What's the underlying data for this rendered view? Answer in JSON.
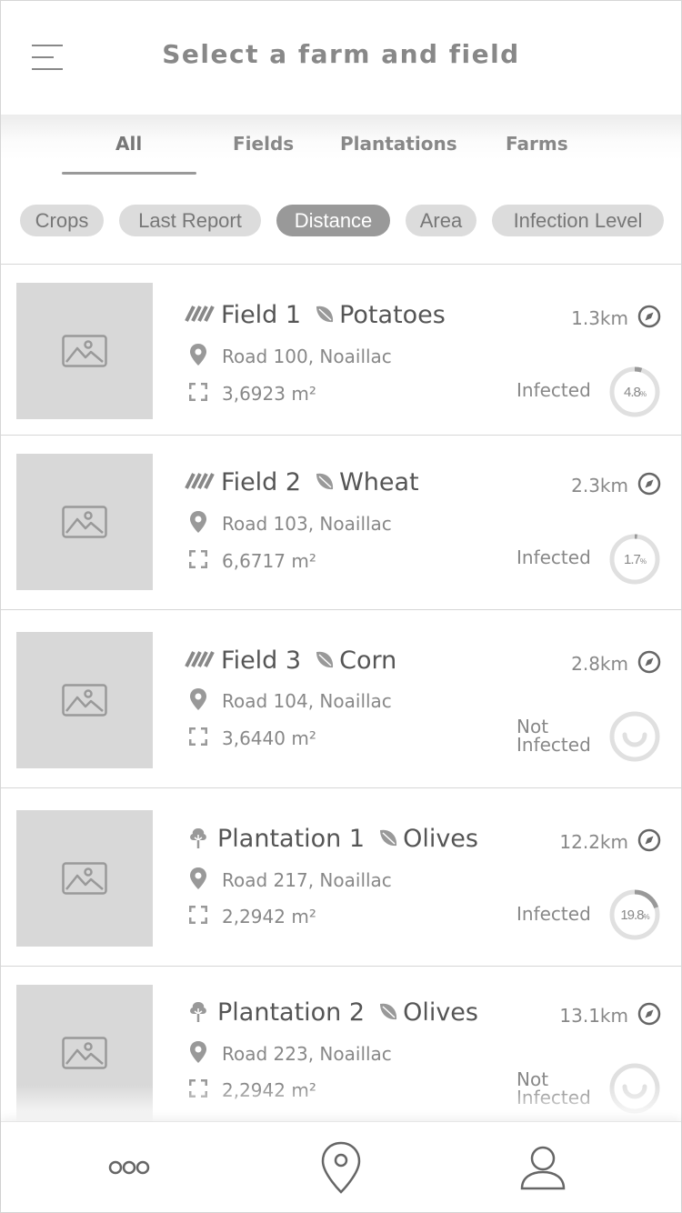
{
  "header": {
    "title": "Select a farm and field",
    "menu_icon": "hamburger-menu-icon"
  },
  "tabs": [
    {
      "label": "All",
      "active": true
    },
    {
      "label": "Fields"
    },
    {
      "label": "Plantations"
    },
    {
      "label": "Farms"
    }
  ],
  "filters": [
    {
      "label": "Crops"
    },
    {
      "label": "Last Report"
    },
    {
      "label": "Distance",
      "active": true
    },
    {
      "label": "Area"
    },
    {
      "label": "Infection Level"
    }
  ],
  "items": [
    {
      "type": "field",
      "type_icon": "field-rows-icon",
      "name": "Field 1",
      "crop": "Potatoes",
      "address": "Road 100, Noaillac",
      "area": "3,6923 m²",
      "distance": "1.3km",
      "status": "Infected",
      "infection_value": "4.8",
      "infection_unit": "%",
      "infection_fraction": 0.048
    },
    {
      "type": "field",
      "type_icon": "field-rows-icon",
      "name": "Field 2",
      "crop": "Wheat",
      "address": "Road 103, Noaillac",
      "area": "6,6717 m²",
      "distance": "2.3km",
      "status": "Infected",
      "infection_value": "1.7",
      "infection_unit": "%",
      "infection_fraction": 0.017
    },
    {
      "type": "field",
      "type_icon": "field-rows-icon",
      "name": "Field 3",
      "crop": "Corn",
      "address": "Road 104, Noaillac",
      "area": "3,6440 m²",
      "distance": "2.8km",
      "status": "Not Infected",
      "status_line1": "Not",
      "status_line2": "Infected"
    },
    {
      "type": "plantation",
      "type_icon": "tree-icon",
      "name": "Plantation 1",
      "crop": "Olives",
      "address": "Road 217, Noaillac",
      "area": "2,2942 m²",
      "distance": "12.2km",
      "status": "Infected",
      "infection_value": "19.8",
      "infection_unit": "%",
      "infection_fraction": 0.198
    },
    {
      "type": "plantation",
      "type_icon": "tree-icon",
      "name": "Plantation 2",
      "crop": "Olives",
      "address": "Road 223, Noaillac",
      "area": "2,2942 m²",
      "distance": "13.1km",
      "status": "Not Infected",
      "status_line1": "Not",
      "status_line2": "Infected"
    }
  ],
  "bottom_nav": [
    {
      "icon": "more-dots-icon"
    },
    {
      "icon": "map-pin-icon"
    },
    {
      "icon": "user-profile-icon"
    }
  ]
}
